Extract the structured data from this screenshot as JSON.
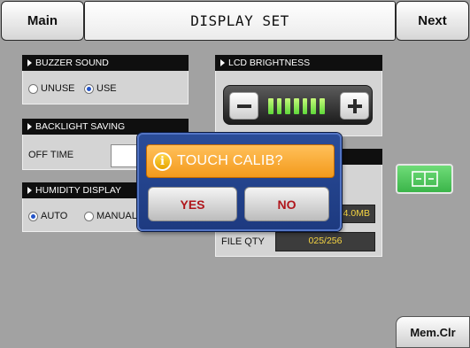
{
  "header": {
    "main_label": "Main",
    "title": "DISPLAY SET",
    "next_label": "Next"
  },
  "buzzer_sound": {
    "title": "BUZZER SOUND",
    "options": [
      {
        "label": "UNUSE",
        "selected": false
      },
      {
        "label": "USE",
        "selected": true
      }
    ]
  },
  "backlight_saving": {
    "title": "BACKLIGHT SAVING",
    "off_time_label": "OFF TIME"
  },
  "humidity_display": {
    "title": "HUMIDITY DISPLAY",
    "options": [
      {
        "label": "AUTO",
        "selected": true
      },
      {
        "label": "MANUAL",
        "selected": false
      }
    ]
  },
  "lcd_brightness": {
    "title": "LCD BRIGHTNESS",
    "level": 7,
    "minus_icon": "minus-icon",
    "plus_icon": "plus-icon"
  },
  "storage": {
    "capacity_value": "4.0MB",
    "file_qty_label": "FILE QTY",
    "file_qty_value": "025/256"
  },
  "dialog": {
    "icon": "info-icon",
    "message": "TOUCH CALIB?",
    "yes_label": "YES",
    "no_label": "NO"
  },
  "side": {
    "calibration_icon": "touch-calibration-icon",
    "mem_clr_label": "Mem.Clr"
  },
  "colors": {
    "background": "#a2a2a2",
    "panel": "#d4d4d4",
    "panel_header": "#0f0f0f",
    "radio_dot": "#2454c8",
    "dialog": "#1d3a80",
    "dialog_border": "#5274c4",
    "dialog_banner": "#f39a1c",
    "dialog_button_text": "#b0161c",
    "value_text": "#f5d442",
    "value_field": "#3c3c3c",
    "level_green": "#5fd83a",
    "accent_green": "#3bb54a"
  }
}
